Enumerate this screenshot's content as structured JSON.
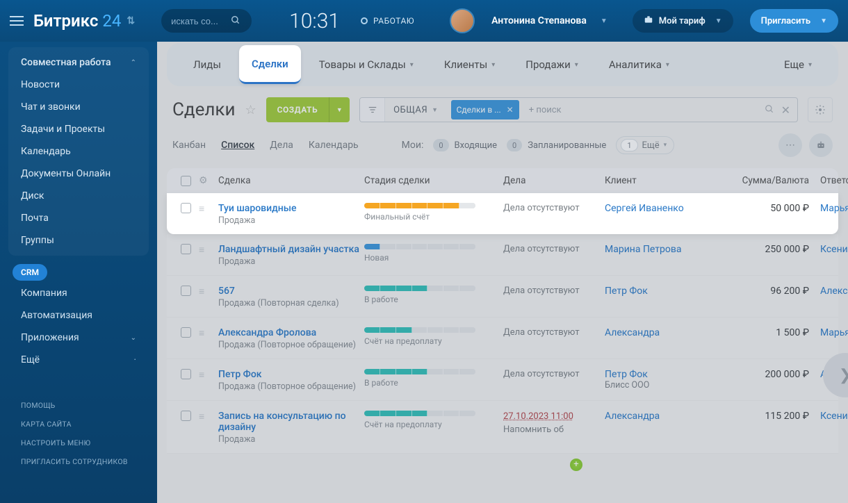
{
  "header": {
    "logo_main": "Битрикс",
    "logo_suffix": "24",
    "search_placeholder": "искать со...",
    "clock": "10:31",
    "work_status": "РАБОТАЮ",
    "user_name": "Антонина Степанова",
    "tariff_label": "Мой тариф",
    "invite_label": "Пригласить"
  },
  "sidebar": {
    "collab": "Совместная работа",
    "items_top": [
      "Новости",
      "Чат и звонки",
      "Задачи и Проекты",
      "Календарь",
      "Документы Онлайн",
      "Диск",
      "Почта",
      "Группы"
    ],
    "crm": "CRM",
    "items_bottom": [
      "Компания",
      "Автоматизация"
    ],
    "apps": "Приложения",
    "more": "Ещё",
    "mini": [
      "ПОМОЩЬ",
      "КАРТА САЙТА",
      "НАСТРОИТЬ МЕНЮ",
      "ПРИГЛАСИТЬ СОТРУДНИКОВ"
    ]
  },
  "crm_tabs": {
    "items": [
      "Лиды",
      "Сделки",
      "Товары и Склады",
      "Клиенты",
      "Продажи",
      "Аналитика"
    ],
    "more": "Еще",
    "active_index": 1
  },
  "titlebar": {
    "title": "Сделки",
    "create": "СОЗДАТЬ",
    "general": "ОБЩАЯ",
    "chip": "Сделки в ...",
    "search_plus": "+ поиск"
  },
  "subtabs": {
    "items": [
      "Канбан",
      "Список",
      "Дела",
      "Календарь"
    ],
    "active_index": 1,
    "mine_label": "Мои:",
    "incoming": "Входящие",
    "planned": "Запланированные",
    "more": "Ещё",
    "badge0": "0",
    "badge1": "0",
    "badge_more": "1"
  },
  "columns": {
    "deal": "Сделка",
    "stage": "Стадия сделки",
    "business": "Дела",
    "client": "Клиент",
    "amount": "Сумма/Валюта",
    "responsible": "Ответст"
  },
  "rows": [
    {
      "name": "Туи шаровидные",
      "sub": "Продажа",
      "stage_label": "Финальный счёт",
      "stage_color": "#f5a623",
      "stage_pct": 85,
      "business": "Дела отсутствуют",
      "client": "Сергей Иваненко",
      "client_sub": "",
      "amount": "50 000 ₽",
      "responsible": "Марьяна",
      "highlight": true
    },
    {
      "name": "Ландшафтный дизайн участка",
      "sub": "Продажа",
      "stage_label": "Новая",
      "stage_color": "#3b97dc",
      "stage_pct": 15,
      "business": "Дела отсутствуют",
      "client": "Марина Петрова",
      "client_sub": "",
      "amount": "250 000 ₽",
      "responsible": "Ксения И"
    },
    {
      "name": "567",
      "sub": "Продажа (Повторная сделка)",
      "stage_label": "В работе",
      "stage_color": "#33c0b9",
      "stage_pct": 62,
      "business": "Дела отсутствуют",
      "client": "Петр Фок",
      "client_sub": "",
      "amount": "96 200 ₽",
      "responsible": "Александ"
    },
    {
      "name": "Александра Фролова",
      "sub": "Продажа (Повторное обращение)",
      "stage_label": "Счёт на предоплату",
      "stage_color": "#33c0b9",
      "stage_pct": 42,
      "business": "Дела отсутствуют",
      "client": "Александра",
      "client_sub": "",
      "amount": "1 500 ₽",
      "responsible": "Марьяна"
    },
    {
      "name": "Петр Фок",
      "sub": "Продажа (Повторное обращение)",
      "stage_label": "В работе",
      "stage_color": "#33c0b9",
      "stage_pct": 62,
      "business": "Дела отсутствуют",
      "client": "Петр Фок",
      "client_sub": "Блисс ООО",
      "amount": "200 000 ₽",
      "responsible": "Антонина Степанов"
    },
    {
      "name": "Запись на консультацию по дизайну",
      "sub": "Продажа",
      "stage_label": "Счёт на предоплату",
      "stage_color": "#33c0b9",
      "stage_pct": 55,
      "business_date": "27.10.2023 11:00",
      "business_extra": "Напомнить об",
      "client": "Александра",
      "client_sub": "",
      "amount": "115 200 ₽",
      "responsible": "Ксения И",
      "has_plus": true
    }
  ]
}
